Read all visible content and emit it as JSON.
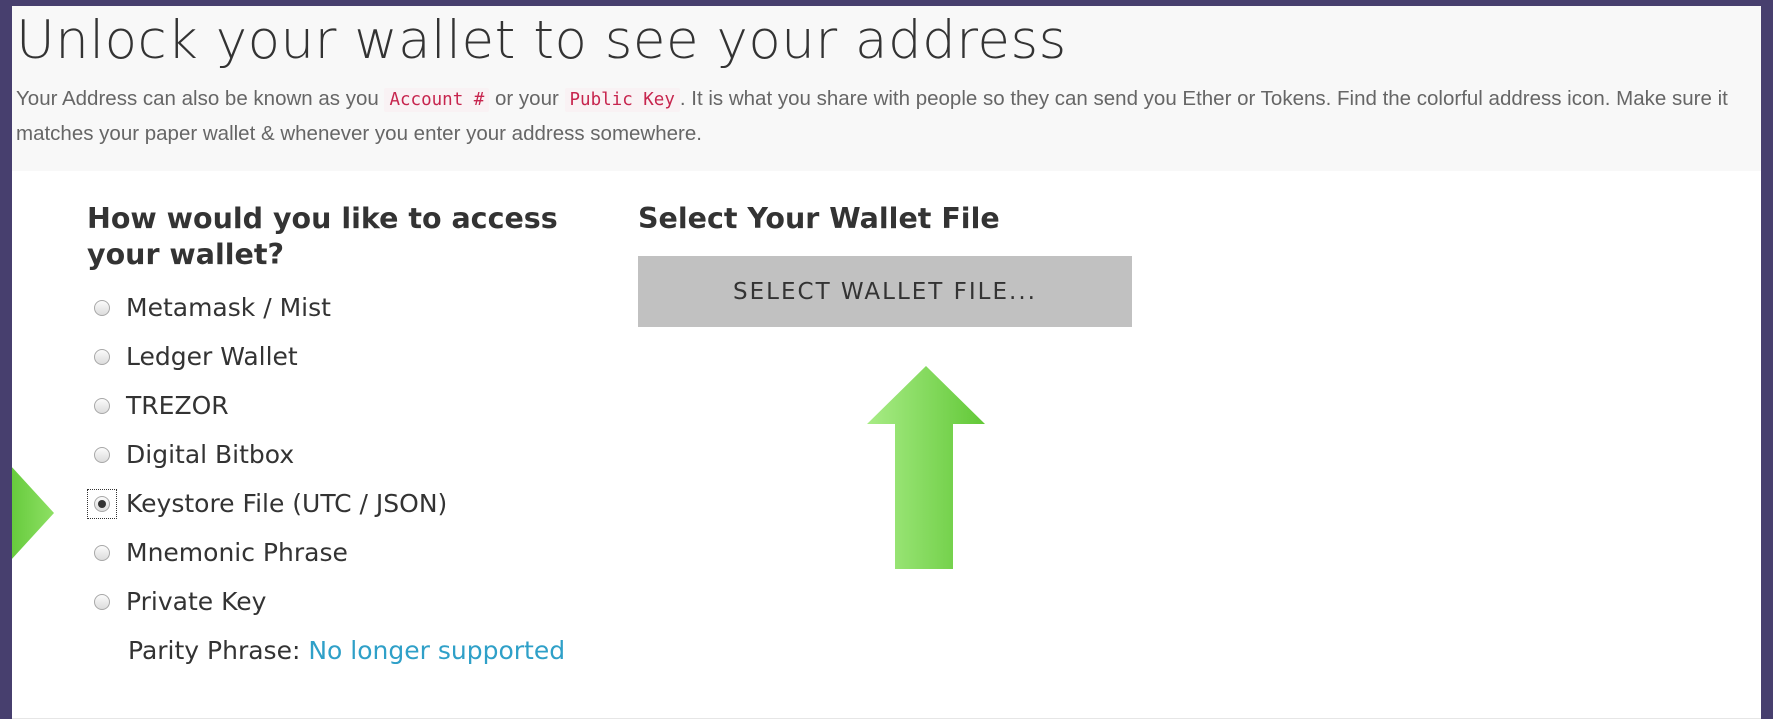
{
  "header": {
    "title": "Unlock your wallet to see your address",
    "desc_1": "Your Address can also be known as you ",
    "code_account": "Account #",
    "desc_2": " or your ",
    "code_public_key": "Public Key",
    "desc_3": ". It is what you share with people so they can send you Ether or Tokens. Find the colorful address icon. Make sure it matches your paper wallet & whenever you enter your address somewhere."
  },
  "access": {
    "heading": "How would you like to access your wallet?",
    "options": [
      {
        "label": "Metamask / Mist",
        "selected": false
      },
      {
        "label": "Ledger Wallet",
        "selected": false
      },
      {
        "label": "TREZOR",
        "selected": false
      },
      {
        "label": "Digital Bitbox",
        "selected": false
      },
      {
        "label": "Keystore File (UTC / JSON)",
        "selected": true
      },
      {
        "label": "Mnemonic Phrase",
        "selected": false
      },
      {
        "label": "Private Key",
        "selected": false
      }
    ],
    "parity_label": "Parity Phrase: ",
    "parity_link": "No longer supported"
  },
  "wallet_file": {
    "heading": "Select Your Wallet File",
    "button_label": "SELECT WALLET FILE..."
  },
  "colors": {
    "frame_bg": "#473f6e",
    "header_bg": "#f8f8f8",
    "button_bg": "#c1c1c1",
    "link": "#2fa0c8",
    "code_text": "#c7254e",
    "arrow_green": "#7ed84a"
  }
}
